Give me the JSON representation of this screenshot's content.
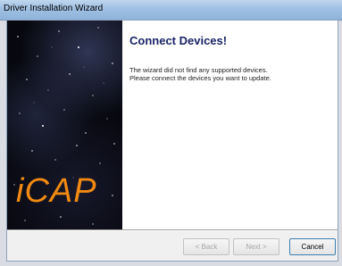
{
  "window": {
    "title": "Driver Installation Wizard"
  },
  "side_panel": {
    "brand": "iCAP"
  },
  "content": {
    "heading": "Connect Devices!",
    "message_line1": "The wizard did not find any supported devices.",
    "message_line2": "Please connect the devices you want to update."
  },
  "buttons": {
    "back": "< Back",
    "next": "Next >",
    "cancel": "Cancel"
  }
}
